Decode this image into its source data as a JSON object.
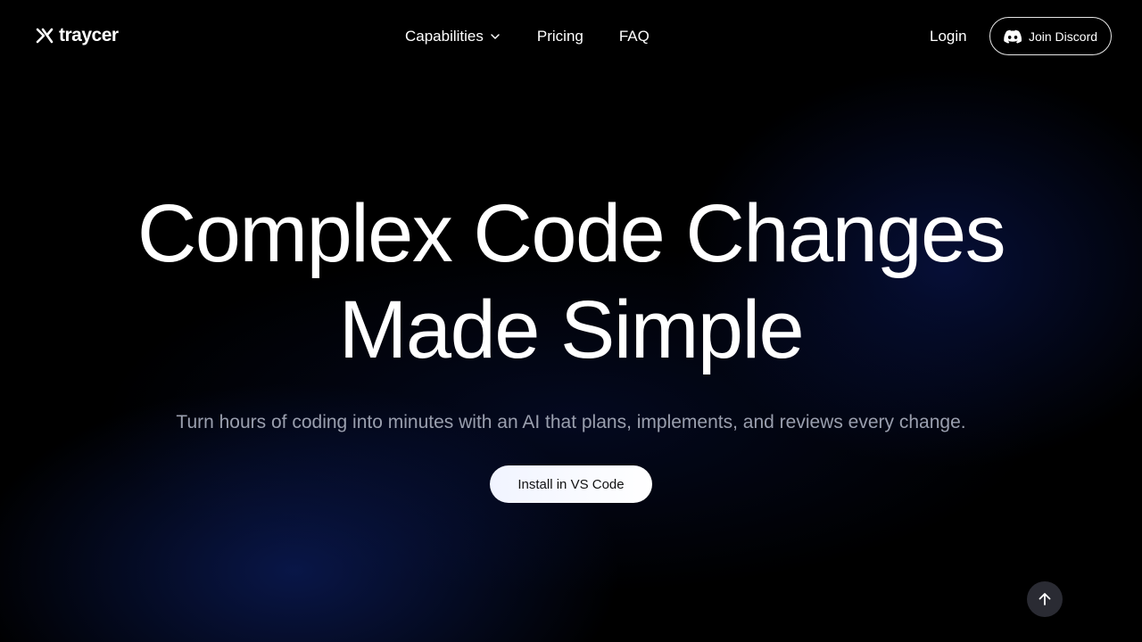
{
  "brand": {
    "name": "traycer",
    "logo_icon": "traycer-logo-icon"
  },
  "nav": {
    "items": [
      {
        "label": "Capabilities",
        "has_dropdown": true,
        "icon": "chevron-down-icon"
      },
      {
        "label": "Pricing"
      },
      {
        "label": "FAQ"
      }
    ]
  },
  "header_actions": {
    "login_label": "Login",
    "discord_label": "Join Discord",
    "discord_icon": "discord-icon"
  },
  "hero": {
    "title_line1": "Complex Code Changes",
    "title_line2": "Made Simple",
    "subtitle": "Turn hours of coding into minutes with an AI that plans, implements, and reviews every change.",
    "cta_label": "Install in VS Code"
  },
  "scroll_top": {
    "icon": "arrow-up-icon"
  },
  "colors": {
    "background": "#000000",
    "text": "#ffffff",
    "subtitle": "#9a9fae",
    "glow": "#10288a",
    "scroll_button": "#2a2b33"
  }
}
